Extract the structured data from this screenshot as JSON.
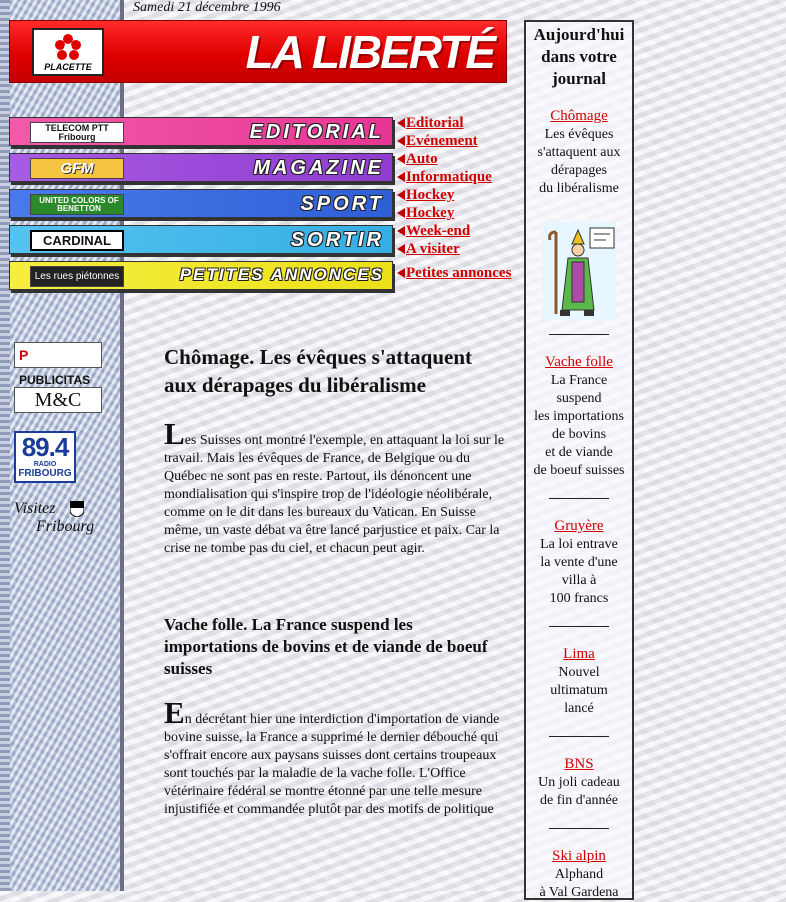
{
  "date": "Samedi 21 décembre 1996",
  "masthead": {
    "logo_label": "PLACETTE",
    "title": "LA LIBERTÉ"
  },
  "sections": [
    {
      "label": "EDITORIAL",
      "sponsor": "TELECOM PTT Fribourg",
      "color": "#ee3f9c",
      "links": [
        "Editorial",
        "Evénement"
      ]
    },
    {
      "label": "MAGAZINE",
      "sponsor": "GFM",
      "color": "#9b46d8",
      "links": [
        "Auto",
        "Informatique"
      ]
    },
    {
      "label": "SPORT",
      "sponsor": "UNITED COLORS OF BENETTON",
      "color": "#3c6ee0",
      "links": [
        "Hockey",
        "Hockey"
      ]
    },
    {
      "label": "SORTIR",
      "sponsor": "CARDINAL",
      "color": "#41b5e8",
      "links": [
        "Week-end",
        "A visiter"
      ]
    },
    {
      "label": "PETITES ANNONCES",
      "sponsor": "Les rues piétonnes",
      "color": "#f2e824",
      "links": [
        "Petites annonces"
      ]
    }
  ],
  "left_logos": {
    "publicitas": "PUBLICITAS",
    "mc": "M&C",
    "radio_freq": "89.4",
    "radio_name": "FRIBOURG",
    "radio_tag": "RADIO",
    "visitez": "Visitez",
    "fribourg": "Fribourg"
  },
  "articles": [
    {
      "title": "Chômage. Les évêques s'attaquent aux dérapages du libéralisme",
      "dropcap": "L",
      "body": "es Suisses ont montré l'exemple, en attaquant la loi sur le travail. Mais les évêques de France, de Belgique ou du Québec ne sont pas en reste. Partout, ils dénoncent une mondialisation qui s'inspire trop de l'idéologie néolibérale, comme on le dit dans les bureaux du Vatican. En Suisse même, un vaste débat va être lancé parjustice et paix. Car la crise ne tombe pas du ciel, et chacun peut agir."
    },
    {
      "title": "Vache folle. La France suspend les importations de bovins et de viande de boeuf suisses",
      "dropcap": "E",
      "body": "n décrétant hier une interdiction d'importation de viande bovine suisse, la France a supprimé le dernier débouché qui s'offrait encore aux paysans suisses dont certains troupeaux sont touchés par la maladie de la vache folle. L'Office vétérinaire fédéral se montre étonné par une telle mesure injustifiée et commandée plutôt par des motifs de politique"
    }
  ],
  "sidebar": {
    "title": "Aujourd'hui dans votre journal",
    "items": [
      {
        "link": "Chômage",
        "lines": [
          "Les évêques",
          "s'attaquent aux",
          "dérapages",
          "du libéralisme"
        ]
      },
      {
        "link": "Vache folle",
        "lines": [
          "La France",
          "suspend",
          "les importations",
          "de bovins",
          "et de viande",
          "de boeuf suisses"
        ]
      },
      {
        "link": "Gruyère",
        "lines": [
          "La loi entrave",
          "la vente d'une",
          "villa à",
          "100 francs"
        ]
      },
      {
        "link": "Lima",
        "lines": [
          "Nouvel",
          "ultimatum",
          "lancé"
        ]
      },
      {
        "link": "BNS",
        "lines": [
          "Un joli cadeau",
          "de fin d'année"
        ]
      },
      {
        "link": "Ski alpin",
        "lines": [
          "Alphand",
          "à Val Gardena"
        ]
      }
    ]
  }
}
